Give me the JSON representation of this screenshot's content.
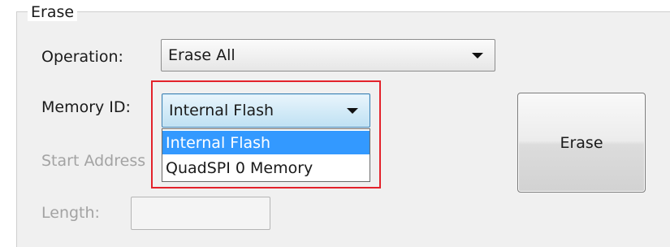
{
  "group": {
    "title": "Erase"
  },
  "operation": {
    "label": "Operation:",
    "value": "Erase All"
  },
  "memory_id": {
    "label": "Memory ID:",
    "value": "Internal Flash",
    "options": [
      "Internal Flash",
      "QuadSPI 0 Memory"
    ],
    "highlighted_option": "Internal Flash"
  },
  "start_address": {
    "label": "Start Address",
    "value": ""
  },
  "length": {
    "label": "Length:",
    "value": ""
  },
  "erase_button": {
    "label": "Erase"
  },
  "colors": {
    "selection_blue": "#3399ff",
    "annotation_red": "#e3222b",
    "disabled_text": "#a3a3a3"
  }
}
